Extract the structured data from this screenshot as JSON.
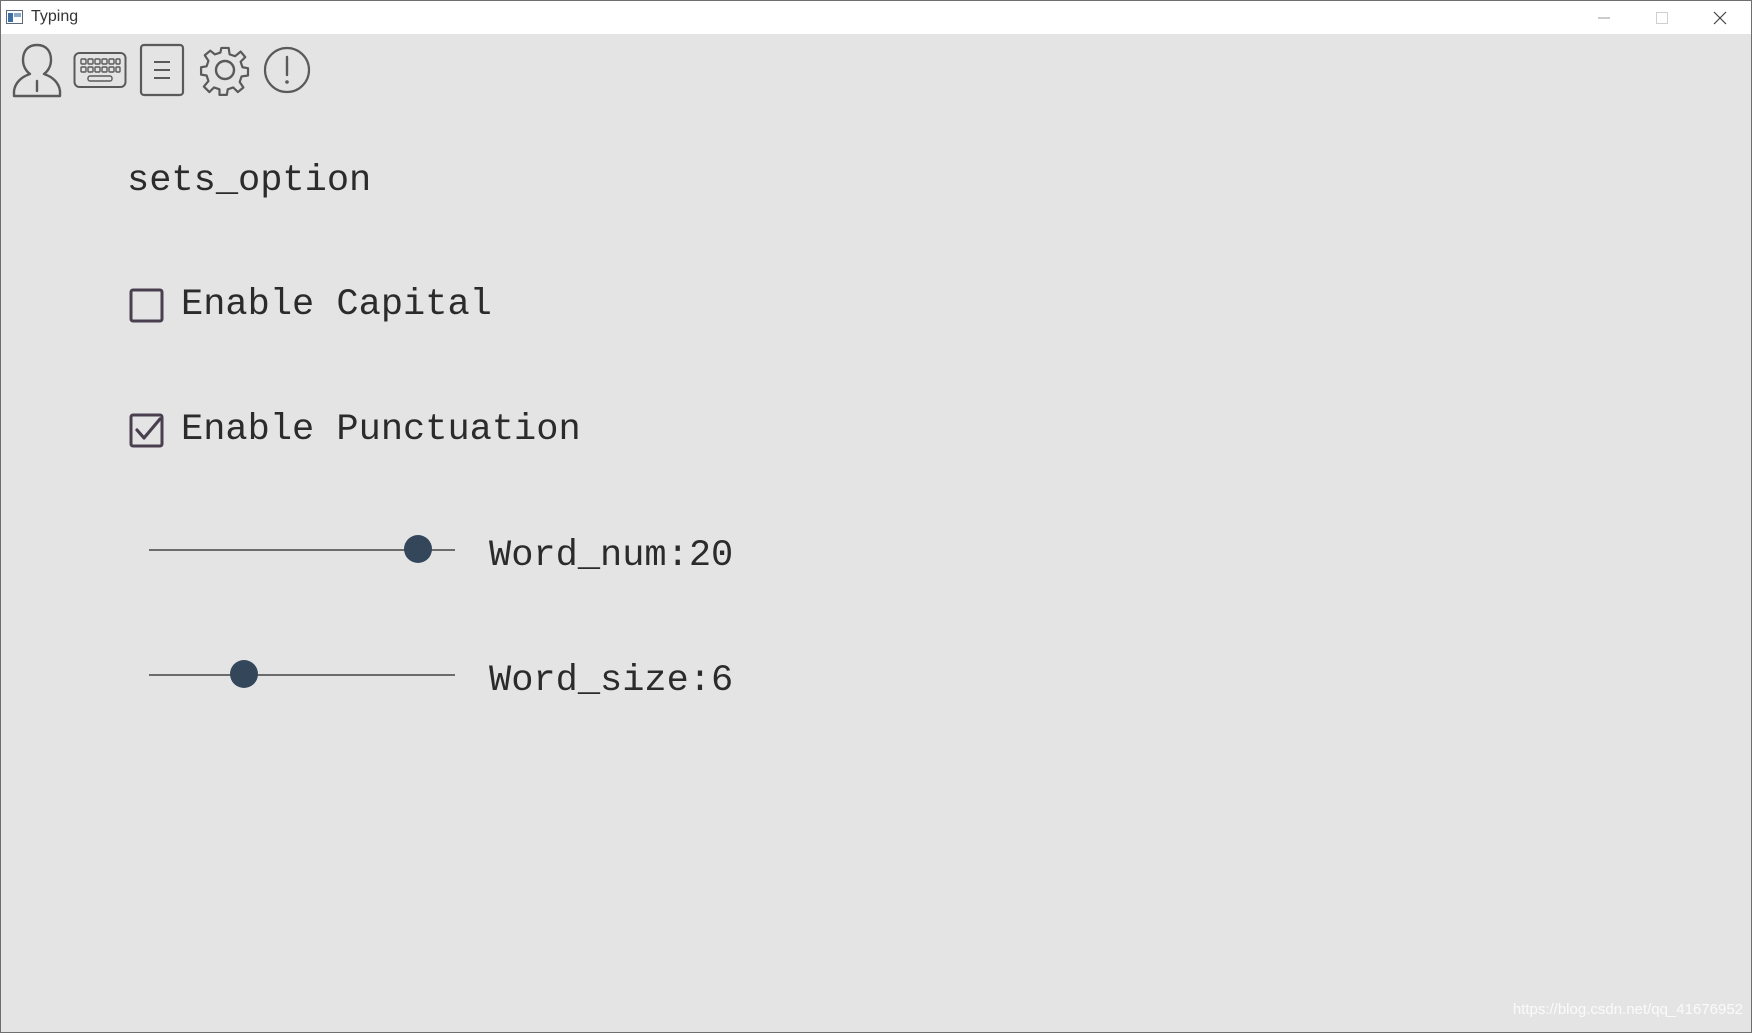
{
  "window": {
    "title": "Typing"
  },
  "toolbar": {
    "items": [
      {
        "icon": "user-icon"
      },
      {
        "icon": "keyboard-icon"
      },
      {
        "icon": "document-icon"
      },
      {
        "icon": "gear-icon"
      },
      {
        "icon": "info-icon"
      }
    ]
  },
  "settings": {
    "heading": "sets_option",
    "enable_capital": {
      "label": "Enable Capital",
      "checked": false
    },
    "enable_punctuation": {
      "label": "Enable Punctuation",
      "checked": true
    },
    "word_num": {
      "label": "Word_num:20",
      "value": 20,
      "fraction": 0.88
    },
    "word_size": {
      "label": "Word_size:6",
      "value": 6,
      "fraction": 0.31
    }
  },
  "watermark": "https://blog.csdn.net/qq_41676952",
  "colors": {
    "background": "#e4e4e4",
    "thumb": "#34465a",
    "text": "#2b2b2b",
    "checkbox_border": "#4a3f4f"
  }
}
